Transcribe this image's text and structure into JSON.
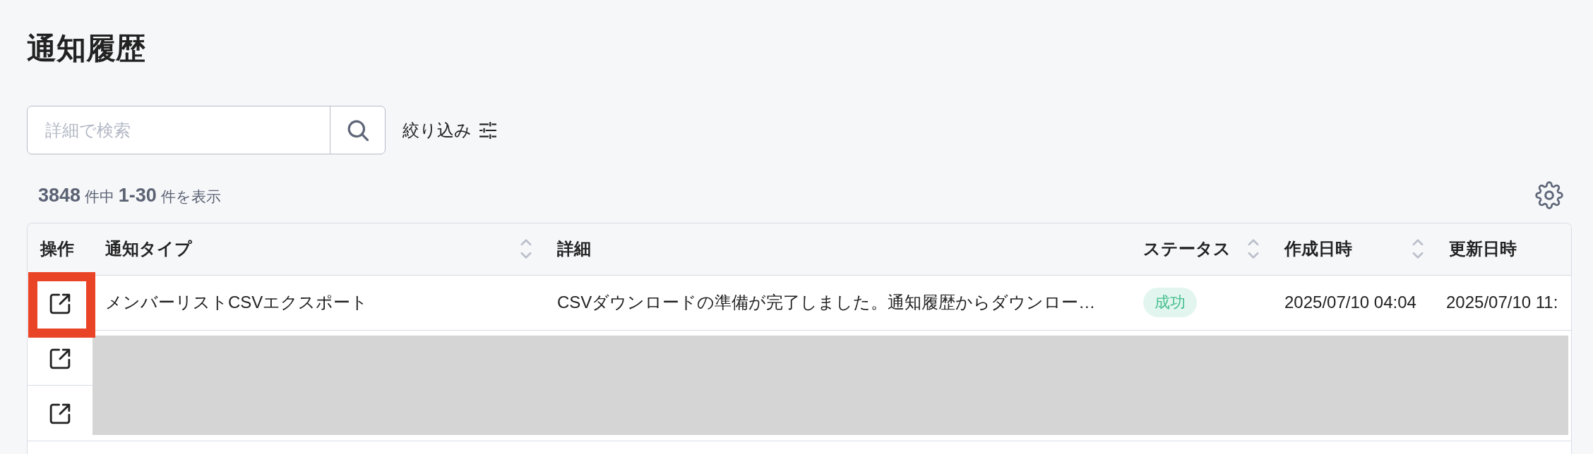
{
  "page": {
    "title": "通知履歴"
  },
  "search": {
    "placeholder": "詳細で検索"
  },
  "filter": {
    "label": "絞り込み"
  },
  "result_count": "**3848** 件中 **1-30** 件を表示",
  "table": {
    "columns": [
      {
        "label": "操作",
        "sortable": false
      },
      {
        "label": "通知タイプ",
        "sortable": true
      },
      {
        "label": "詳細",
        "sortable": false
      },
      {
        "label": "ステータス",
        "sortable": true
      },
      {
        "label": "作成日時",
        "sortable": true
      },
      {
        "label": "更新日時",
        "sortable": false
      }
    ],
    "rows": [
      {
        "highlighted": true,
        "redacted": false,
        "type": "メンバーリストCSVエクスポート",
        "detail": "CSVダウンロードの準備が完了しました。通知履歴からダウンロー…",
        "status": {
          "label": "成功",
          "kind": "success"
        },
        "created": "2025/07/10 04:04",
        "updated": "2025/07/10 11:"
      },
      {
        "highlighted": false,
        "redacted": true
      },
      {
        "highlighted": false,
        "redacted": true
      }
    ]
  }
}
